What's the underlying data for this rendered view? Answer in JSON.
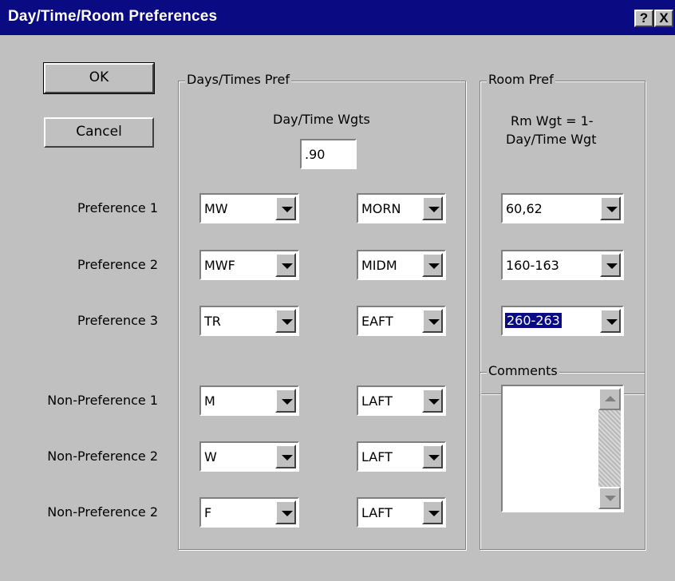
{
  "window": {
    "title": "Day/Time/Room Preferences",
    "help_label": "?",
    "close_label": "X"
  },
  "buttons": {
    "ok": "OK",
    "cancel": "Cancel"
  },
  "days_times": {
    "group_label": "Days/Times Pref",
    "weights_label": "Day/Time Wgts",
    "weights_value": ".90"
  },
  "room": {
    "group_label": "Room Pref",
    "weight_line1": "Rm Wgt = 1-",
    "weight_line2": "Day/Time Wgt"
  },
  "comments": {
    "group_label": "Comments",
    "text": ""
  },
  "rows": [
    {
      "label": "Preference 1",
      "day": "MW",
      "time": "MORN",
      "room": "60,62"
    },
    {
      "label": "Preference 2",
      "day": "MWF",
      "time": "MIDM",
      "room": "160-163"
    },
    {
      "label": "Preference 3",
      "day": "TR",
      "time": "EAFT",
      "room": "260-263"
    },
    {
      "label": "Non-Preference 1",
      "day": "M",
      "time": "LAFT"
    },
    {
      "label": "Non-Preference 2",
      "day": "W",
      "time": "LAFT"
    },
    {
      "label": "Non-Preference 2",
      "day": "F",
      "time": "LAFT"
    }
  ]
}
